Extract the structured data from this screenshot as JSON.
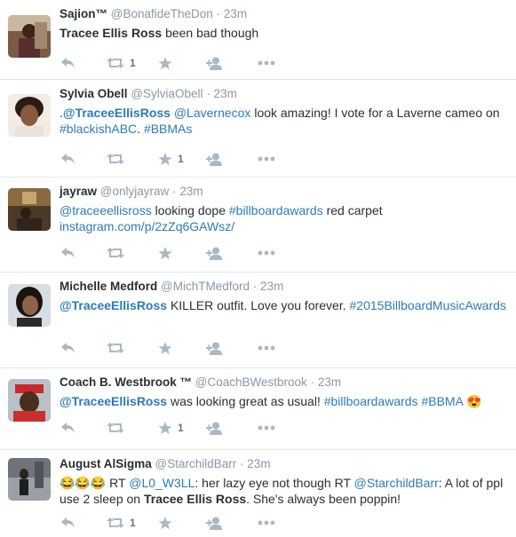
{
  "colors": {
    "link": "#2b7bb9",
    "muted": "#8899a6",
    "icon": "#aab8c2",
    "text": "#292f33"
  },
  "tweets": [
    {
      "name": "Sajion™",
      "handle": "@BonafideTheDon",
      "time": "23m",
      "segments": [
        {
          "text": "Tracee Ellis Ross",
          "style": "bold"
        },
        {
          "text": " been bad though",
          "style": "plain"
        }
      ],
      "retweets": "1",
      "favorites": ""
    },
    {
      "name": "Sylvia Obell",
      "handle": "@SylviaObell",
      "time": "23m",
      "segments": [
        {
          "text": ".",
          "style": "plain"
        },
        {
          "text": "@TraceeEllisRoss",
          "style": "link-bold"
        },
        {
          "text": " ",
          "style": "plain"
        },
        {
          "text": "@Lavernecox",
          "style": "link"
        },
        {
          "text": " look amazing! I vote for a Laverne cameo on ",
          "style": "plain"
        },
        {
          "text": "#blackishABC",
          "style": "link"
        },
        {
          "text": ". ",
          "style": "plain"
        },
        {
          "text": "#BBMAs",
          "style": "link"
        }
      ],
      "retweets": "",
      "favorites": "1"
    },
    {
      "name": "jayraw",
      "handle": "@onlyjayraw",
      "time": "23m",
      "segments": [
        {
          "text": "@traceeellisross",
          "style": "link"
        },
        {
          "text": " looking dope ",
          "style": "plain"
        },
        {
          "text": "#billboardawards",
          "style": "link"
        },
        {
          "text": " red carpet ",
          "style": "plain"
        },
        {
          "text": "instagram.com/p/2zZq6GAWsz/",
          "style": "link"
        }
      ],
      "retweets": "",
      "favorites": ""
    },
    {
      "name": "Michelle Medford",
      "handle": "@MichTMedford",
      "time": "23m",
      "segments": [
        {
          "text": "@TraceeEllisRoss",
          "style": "link-bold"
        },
        {
          "text": " KILLER outfit. Love you forever. ",
          "style": "plain"
        },
        {
          "text": "#2015BillboardMusicAwards",
          "style": "link"
        }
      ],
      "retweets": "",
      "favorites": ""
    },
    {
      "name": "Coach B. Westbrook ™",
      "handle": "@CoachBWestbrook",
      "time": "23m",
      "segments": [
        {
          "text": "@TraceeEllisRoss",
          "style": "link-bold"
        },
        {
          "text": " was looking great as usual! ",
          "style": "plain"
        },
        {
          "text": "#billboardawards",
          "style": "link"
        },
        {
          "text": " ",
          "style": "plain"
        },
        {
          "text": "#BBMA",
          "style": "link"
        },
        {
          "text": " 😍",
          "style": "plain"
        }
      ],
      "retweets": "",
      "favorites": "1"
    },
    {
      "name": "August AlSigma",
      "handle": "@StarchildBarr",
      "time": "23m",
      "segments": [
        {
          "text": "😂😂😂 RT ",
          "style": "plain"
        },
        {
          "text": "@L0_W3LL",
          "style": "link"
        },
        {
          "text": ": her lazy eye not though RT ",
          "style": "plain"
        },
        {
          "text": "@StarchildBarr",
          "style": "link"
        },
        {
          "text": ": A lot of ppl use 2 sleep on ",
          "style": "plain"
        },
        {
          "text": "Tracee Ellis Ross",
          "style": "bold"
        },
        {
          "text": ". She's always been poppin!",
          "style": "plain"
        }
      ],
      "retweets": "1",
      "favorites": ""
    }
  ],
  "icons": {
    "reply": "reply-icon",
    "retweet": "retweet-icon",
    "favorite": "star-icon",
    "follow": "follow-icon",
    "more": "more-icon"
  }
}
